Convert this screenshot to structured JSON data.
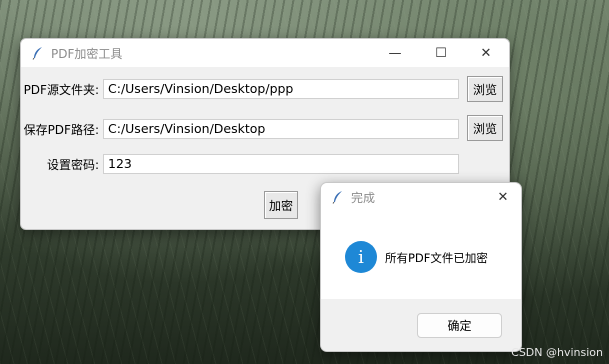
{
  "main_window": {
    "title": "PDF加密工具",
    "controls": {
      "minimize": "—",
      "maximize": "☐",
      "close": "✕"
    },
    "fields": [
      {
        "label": "PDF源文件夹:",
        "value": "C:/Users/Vinsion/Desktop/ppp",
        "button": "浏览"
      },
      {
        "label": "保存PDF路径:",
        "value": "C:/Users/Vinsion/Desktop",
        "button": "浏览"
      },
      {
        "label": "设置密码:",
        "value": "123"
      }
    ],
    "encrypt_button": "加密"
  },
  "dialog": {
    "title": "完成",
    "close": "✕",
    "icon_glyph": "i",
    "message": "所有PDF文件已加密",
    "ok_button": "确定"
  },
  "watermark": "CSDN @hvinsion",
  "icons": [
    "feather-icon",
    "info-icon"
  ],
  "colors": {
    "info_blue": "#1e88d6",
    "title_grey": "#8c8c8c",
    "window_bg": "#f0f0f0"
  }
}
